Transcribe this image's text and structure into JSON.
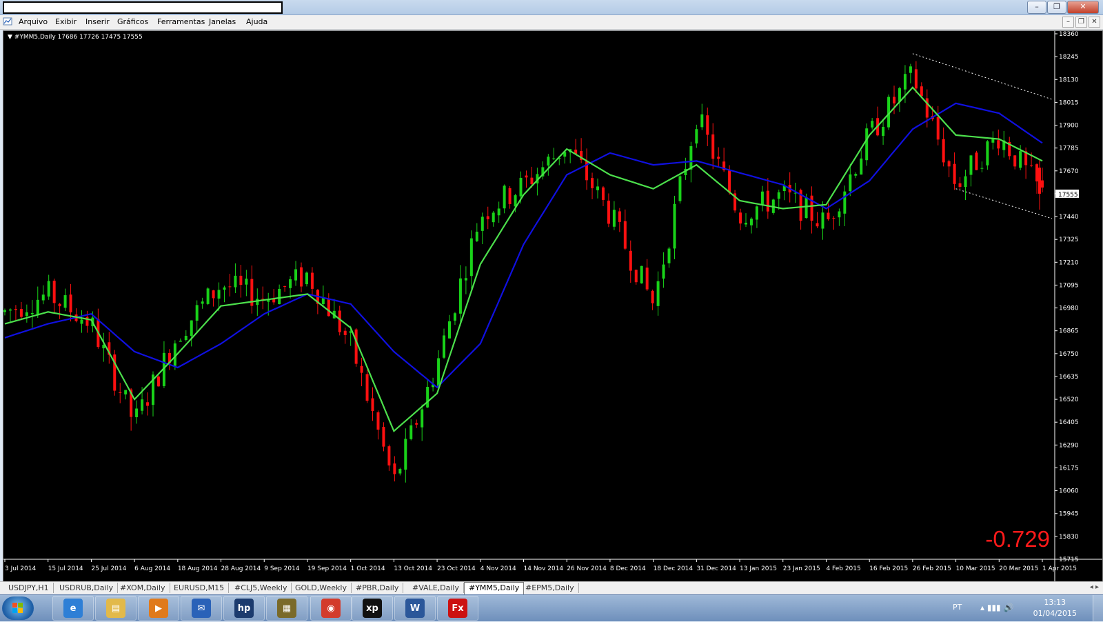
{
  "menu": {
    "items": [
      "Arquivo",
      "Exibir",
      "Inserir",
      "Gráficos",
      "Ferramentas",
      "Janelas",
      "Ajuda"
    ]
  },
  "window": {
    "minimize_glyph": "–",
    "maximize_glyph": "❐",
    "close_glyph": "✕"
  },
  "chart_info": {
    "symbol_line": "#YMM5,Daily  17686 17726 17475 17555",
    "big_value": "-0.729",
    "current_price": "17555",
    "price_levels": [
      "18360",
      "18245",
      "18130",
      "18015",
      "17900",
      "17785",
      "17670",
      "17555",
      "17440",
      "17325",
      "17210",
      "17095",
      "16980",
      "16865",
      "16750",
      "16635",
      "16520",
      "16405",
      "16290",
      "16175",
      "16060",
      "15945",
      "15830",
      "15715"
    ],
    "date_labels": [
      "3 Jul 2014",
      "15 Jul 2014",
      "25 Jul 2014",
      "6 Aug 2014",
      "18 Aug 2014",
      "28 Aug 2014",
      "9 Sep 2014",
      "19 Sep 2014",
      "1 Oct 2014",
      "13 Oct 2014",
      "23 Oct 2014",
      "4 Nov 2014",
      "14 Nov 2014",
      "26 Nov 2014",
      "8 Dec 2014",
      "18 Dec 2014",
      "31 Dec 2014",
      "13 Jan 2015",
      "23 Jan 2015",
      "4 Feb 2015",
      "16 Feb 2015",
      "26 Feb 2015",
      "10 Mar 2015",
      "20 Mar 2015",
      "1 Apr 2015"
    ]
  },
  "chart_data": {
    "type": "candlestick",
    "symbol": "#YMM5",
    "timeframe": "Daily",
    "ohlc_last": {
      "open": 17686,
      "high": 17726,
      "low": 17475,
      "close": 17555
    },
    "ylim": [
      15715,
      18360
    ],
    "colors": {
      "up": "#19d219",
      "down": "#ff1010",
      "fast_ma": "#4ce04c",
      "slow_ma": "#1010e0",
      "channel": "#ffffff",
      "background": "#000000"
    },
    "close_path": [
      {
        "date": "3 Jul 2014",
        "value": 16960
      },
      {
        "date": "15 Jul 2014",
        "value": 17050
      },
      {
        "date": "25 Jul 2014",
        "value": 16900
      },
      {
        "date": "6 Aug 2014",
        "value": 16400
      },
      {
        "date": "18 Aug 2014",
        "value": 16850
      },
      {
        "date": "28 Aug 2014",
        "value": 17100
      },
      {
        "date": "9 Sep 2014",
        "value": 17030
      },
      {
        "date": "19 Sep 2014",
        "value": 17150
      },
      {
        "date": "1 Oct 2014",
        "value": 16800
      },
      {
        "date": "13 Oct 2014",
        "value": 16100
      },
      {
        "date": "23 Oct 2014",
        "value": 16700
      },
      {
        "date": "4 Nov 2014",
        "value": 17450
      },
      {
        "date": "14 Nov 2014",
        "value": 17600
      },
      {
        "date": "26 Nov 2014",
        "value": 17800
      },
      {
        "date": "8 Dec 2014",
        "value": 17450
      },
      {
        "date": "18 Dec 2014",
        "value": 17000
      },
      {
        "date": "31 Dec 2014",
        "value": 17950
      },
      {
        "date": "13 Jan 2015",
        "value": 17450
      },
      {
        "date": "23 Jan 2015",
        "value": 17550
      },
      {
        "date": "4 Feb 2015",
        "value": 17400
      },
      {
        "date": "16 Feb 2015",
        "value": 17850
      },
      {
        "date": "26 Feb 2015",
        "value": 18150
      },
      {
        "date": "10 Mar 2015",
        "value": 17600
      },
      {
        "date": "20 Mar 2015",
        "value": 17850
      },
      {
        "date": "1 Apr 2015",
        "value": 17555
      }
    ],
    "fast_ma_path": [
      {
        "date": "3 Jul 2014",
        "value": 16900
      },
      {
        "date": "15 Jul 2014",
        "value": 16960
      },
      {
        "date": "25 Jul 2014",
        "value": 16920
      },
      {
        "date": "6 Aug 2014",
        "value": 16520
      },
      {
        "date": "18 Aug 2014",
        "value": 16750
      },
      {
        "date": "28 Aug 2014",
        "value": 16990
      },
      {
        "date": "9 Sep 2014",
        "value": 17020
      },
      {
        "date": "19 Sep 2014",
        "value": 17050
      },
      {
        "date": "1 Oct 2014",
        "value": 16880
      },
      {
        "date": "13 Oct 2014",
        "value": 16360
      },
      {
        "date": "23 Oct 2014",
        "value": 16550
      },
      {
        "date": "4 Nov 2014",
        "value": 17200
      },
      {
        "date": "14 Nov 2014",
        "value": 17550
      },
      {
        "date": "26 Nov 2014",
        "value": 17780
      },
      {
        "date": "8 Dec 2014",
        "value": 17650
      },
      {
        "date": "18 Dec 2014",
        "value": 17580
      },
      {
        "date": "31 Dec 2014",
        "value": 17700
      },
      {
        "date": "13 Jan 2015",
        "value": 17520
      },
      {
        "date": "23 Jan 2015",
        "value": 17480
      },
      {
        "date": "4 Feb 2015",
        "value": 17500
      },
      {
        "date": "16 Feb 2015",
        "value": 17850
      },
      {
        "date": "26 Feb 2015",
        "value": 18090
      },
      {
        "date": "10 Mar 2015",
        "value": 17850
      },
      {
        "date": "20 Mar 2015",
        "value": 17830
      },
      {
        "date": "1 Apr 2015",
        "value": 17720
      }
    ],
    "slow_ma_path": [
      {
        "date": "3 Jul 2014",
        "value": 16830
      },
      {
        "date": "15 Jul 2014",
        "value": 16900
      },
      {
        "date": "25 Jul 2014",
        "value": 16950
      },
      {
        "date": "6 Aug 2014",
        "value": 16760
      },
      {
        "date": "18 Aug 2014",
        "value": 16680
      },
      {
        "date": "28 Aug 2014",
        "value": 16800
      },
      {
        "date": "9 Sep 2014",
        "value": 16950
      },
      {
        "date": "19 Sep 2014",
        "value": 17050
      },
      {
        "date": "1 Oct 2014",
        "value": 17000
      },
      {
        "date": "13 Oct 2014",
        "value": 16760
      },
      {
        "date": "23 Oct 2014",
        "value": 16580
      },
      {
        "date": "4 Nov 2014",
        "value": 16800
      },
      {
        "date": "14 Nov 2014",
        "value": 17300
      },
      {
        "date": "26 Nov 2014",
        "value": 17650
      },
      {
        "date": "8 Dec 2014",
        "value": 17760
      },
      {
        "date": "18 Dec 2014",
        "value": 17700
      },
      {
        "date": "31 Dec 2014",
        "value": 17720
      },
      {
        "date": "13 Jan 2015",
        "value": 17660
      },
      {
        "date": "23 Jan 2015",
        "value": 17600
      },
      {
        "date": "4 Feb 2015",
        "value": 17480
      },
      {
        "date": "16 Feb 2015",
        "value": 17620
      },
      {
        "date": "26 Feb 2015",
        "value": 17880
      },
      {
        "date": "10 Mar 2015",
        "value": 18010
      },
      {
        "date": "20 Mar 2015",
        "value": 17960
      },
      {
        "date": "1 Apr 2015",
        "value": 17810
      }
    ],
    "channel": {
      "upper": [
        {
          "date": "26 Feb 2015",
          "value": 18260
        },
        {
          "date": "1 Apr 2015",
          "value": 18030
        }
      ],
      "lower": [
        {
          "date": "10 Mar 2015",
          "value": 17580
        },
        {
          "date": "1 Apr 2015",
          "value": 17430
        }
      ]
    }
  },
  "tabs": {
    "items": [
      "USDJPY,H1",
      "USDRUB,Daily",
      "#XOM,Daily",
      "EURUSD,M15",
      "#CLJ5,Weekly",
      "GOLD,Weekly",
      "#PBR,Daily",
      "#VALE,Daily",
      "#YMM5,Daily",
      "#EPM5,Daily"
    ],
    "active": "#YMM5,Daily",
    "arrows": "◂ ▸"
  },
  "taskbar": {
    "apps": [
      {
        "name": "internet-explorer",
        "glyph": "e",
        "color": "#2e7fd6"
      },
      {
        "name": "file-explorer",
        "glyph": "▤",
        "color": "#e2b94a"
      },
      {
        "name": "media-player",
        "glyph": "▶",
        "color": "#e07a1c"
      },
      {
        "name": "outlook",
        "glyph": "✉",
        "color": "#2a62b8"
      },
      {
        "name": "hp-app",
        "glyph": "hp",
        "color": "#1c3b6e"
      },
      {
        "name": "archive-app",
        "glyph": "▦",
        "color": "#7a6a2a"
      },
      {
        "name": "chrome",
        "glyph": "◉",
        "color": "#d33b2c"
      },
      {
        "name": "xp-broker",
        "glyph": "xp",
        "color": "#111111"
      },
      {
        "name": "word",
        "glyph": "W",
        "color": "#2b579a"
      },
      {
        "name": "fxpro",
        "glyph": "Fx",
        "color": "#cc1111"
      }
    ],
    "language": "PT",
    "tray_icons": "▴  ▮▮▮  🔊",
    "time": "13:13",
    "date": "01/04/2015"
  }
}
